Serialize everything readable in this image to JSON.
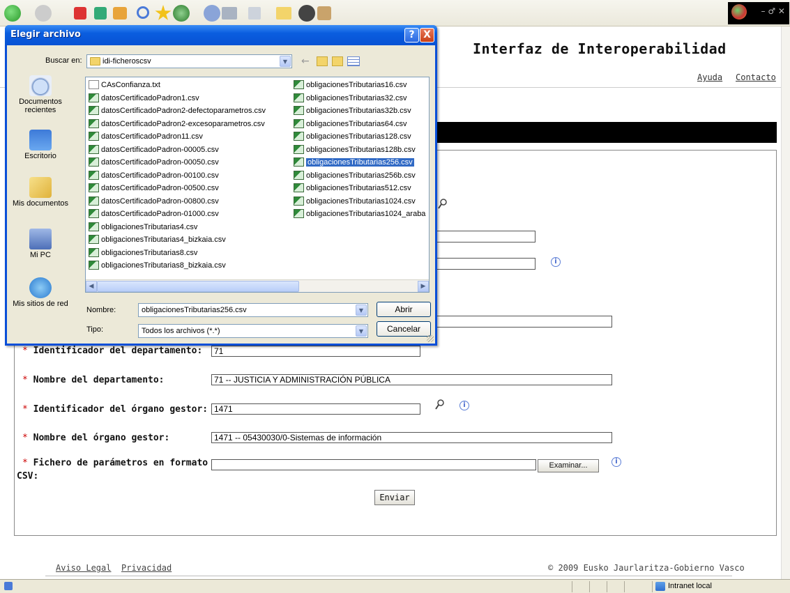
{
  "browser": {
    "status_zone": "Intranet local"
  },
  "page": {
    "title": "Interfaz de Interoperabilidad",
    "links": {
      "help": "Ayuda",
      "contact": "Contacto"
    },
    "form": {
      "dept_id_label": "Identificador del departamento:",
      "dept_id_value": "71",
      "dept_name_label": "Nombre del departamento:",
      "dept_name_value": "71 -- JUSTICIA Y ADMINISTRACIÓN PÚBLICA",
      "organ_id_label": "Identificador del órgano gestor:",
      "organ_id_value": "1471",
      "organ_name_label": "Nombre del órgano gestor:",
      "organ_name_value": "1471 -- 05430030/0-Sistemas de información",
      "csv_label_line1": "Fichero de parámetros en formato",
      "csv_label_line2": "CSV:",
      "csv_value": "",
      "browse_button": "Examinar...",
      "submit_button": "Enviar"
    },
    "footer": {
      "legal": "Aviso Legal",
      "privacy": "Privacidad",
      "copyright": "© 2009 Eusko Jaurlaritza-Gobierno Vasco"
    }
  },
  "dialog": {
    "title": "Elegir archivo",
    "look_in_label": "Buscar en:",
    "look_in_value": "idi-ficheroscsv",
    "places": [
      "Documentos recientes",
      "Escritorio",
      "Mis documentos",
      "Mi PC",
      "Mis sitios de red"
    ],
    "files_col1": [
      "CAsConfianza.txt",
      "datosCertificadoPadron1.csv",
      "datosCertificadoPadron2-defectoparametros.csv",
      "datosCertificadoPadron2-excesoparametros.csv",
      "datosCertificadoPadron11.csv",
      "datosCertificadoPadron-00005.csv",
      "datosCertificadoPadron-00050.csv",
      "datosCertificadoPadron-00100.csv",
      "datosCertificadoPadron-00500.csv",
      "datosCertificadoPadron-00800.csv",
      "datosCertificadoPadron-01000.csv",
      "obligacionesTributarias4.csv",
      "obligacionesTributarias4_bizkaia.csv",
      "obligacionesTributarias8.csv",
      "obligacionesTributarias8_bizkaia.csv"
    ],
    "files_col2": [
      "obligacionesTributarias16.csv",
      "obligacionesTributarias32.csv",
      "obligacionesTributarias32b.csv",
      "obligacionesTributarias64.csv",
      "obligacionesTributarias128.csv",
      "obligacionesTributarias128b.csv",
      "obligacionesTributarias256.csv",
      "obligacionesTributarias256b.csv",
      "obligacionesTributarias512.csv",
      "obligacionesTributarias1024.csv",
      "obligacionesTributarias1024_araba"
    ],
    "selected_file": "obligacionesTributarias256.csv",
    "name_label": "Nombre:",
    "name_value": "obligacionesTributarias256.csv",
    "type_label": "Tipo:",
    "type_value": "Todos los archivos (*.*)",
    "open_button": "Abrir",
    "cancel_button": "Cancelar",
    "help_button": "?",
    "close_button": "X"
  }
}
